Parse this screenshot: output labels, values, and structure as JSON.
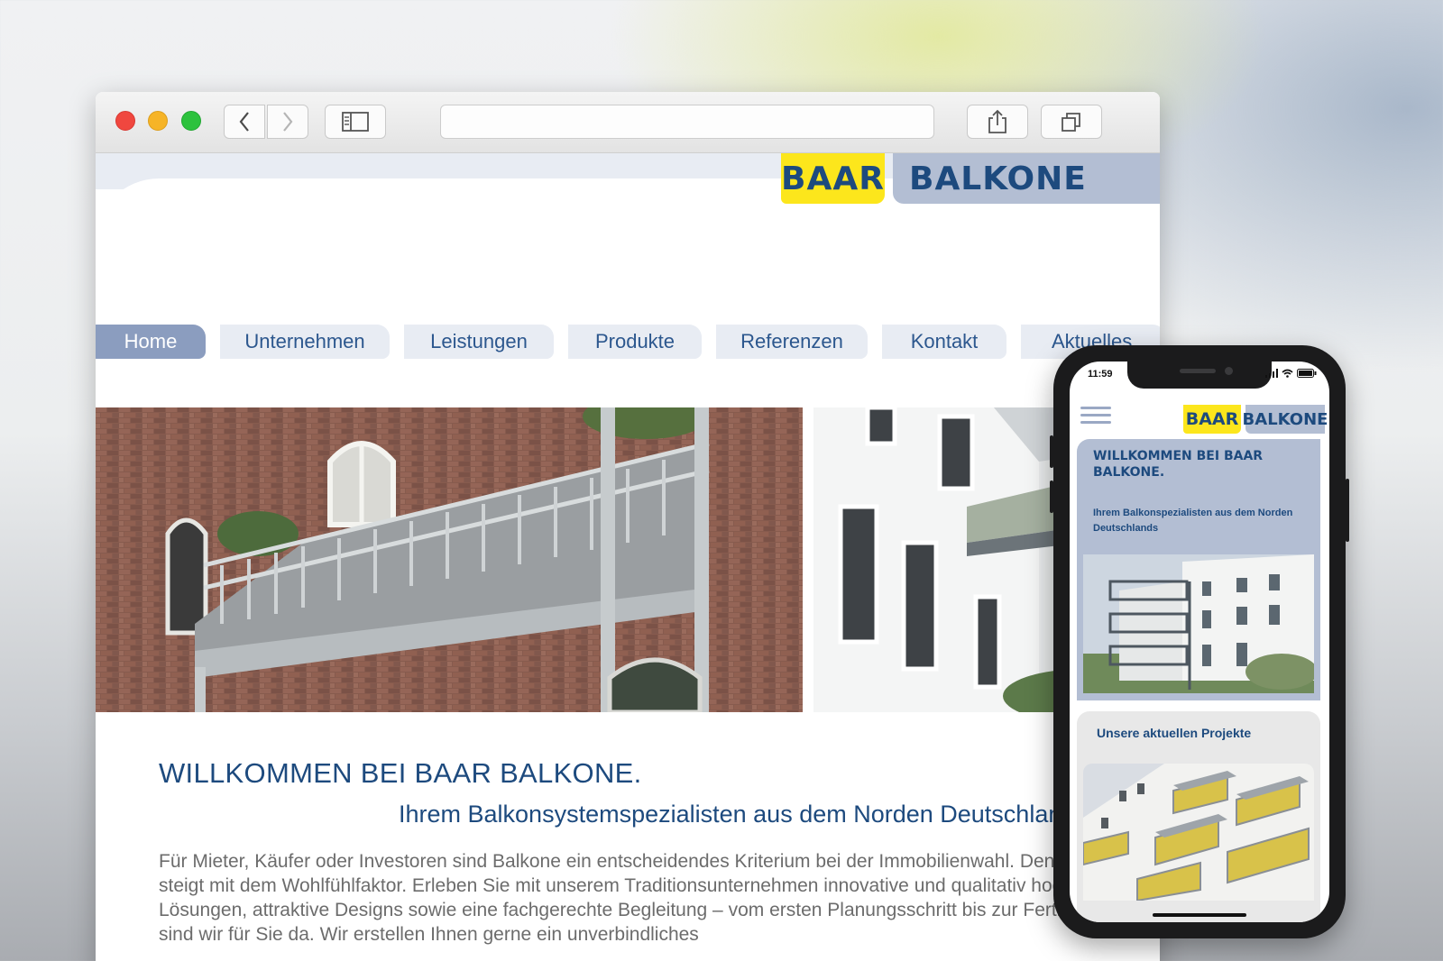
{
  "browser": {
    "url": "",
    "toolbar": {
      "back_icon": "chevron-left-icon",
      "forward_icon": "chevron-right-icon",
      "sidebar_icon": "sidebar-icon",
      "share_icon": "share-icon",
      "tabs_icon": "tabs-icon"
    }
  },
  "site": {
    "logo": {
      "part1": "BAAR",
      "part2": "BALKONE"
    },
    "colors": {
      "brand_blue": "#1d4a7e",
      "brand_yellow": "#fce61c",
      "brand_grey_blue": "#b3bed3",
      "nav_active": "#8b9dbf"
    },
    "nav": [
      {
        "label": "Home",
        "active": true
      },
      {
        "label": "Unternehmen"
      },
      {
        "label": "Leistungen"
      },
      {
        "label": "Produkte"
      },
      {
        "label": "Referenzen"
      },
      {
        "label": "Kontakt"
      },
      {
        "label": "Aktuelles"
      }
    ],
    "welcome_title": "WILLKOMMEN BEI BAAR BALKONE.",
    "subtitle": "Ihrem Balkonsystemspezialisten aus dem Norden Deutschlands",
    "body": "Für Mieter, Käufer oder Investoren sind Balkone ein entscheidendes Kriterium bei der Immobilienwahl. Denn der Wert steigt mit dem Wohlfühlfaktor. Erleben Sie mit unserem Traditionsunternehmen innovative und qualitativ hochwertige Lösungen, attraktive Designs sowie eine fachgerechte Begleitung – vom ersten Planungsschritt bis zur Fertigstellung sind wir für Sie da. Wir erstellen Ihnen gerne ein unverbindliches"
  },
  "phone": {
    "time": "11:59",
    "menu_icon": "hamburger-menu-icon",
    "logo": {
      "part1": "BAAR",
      "part2": "BALKONE"
    },
    "welcome_title": "WILLKOMMEN BEI BAAR BALKONE.",
    "subtitle": "Ihrem Balkonspezialisten aus dem Norden Deutschlands",
    "projects_title": "Unsere aktuellen Projekte"
  }
}
